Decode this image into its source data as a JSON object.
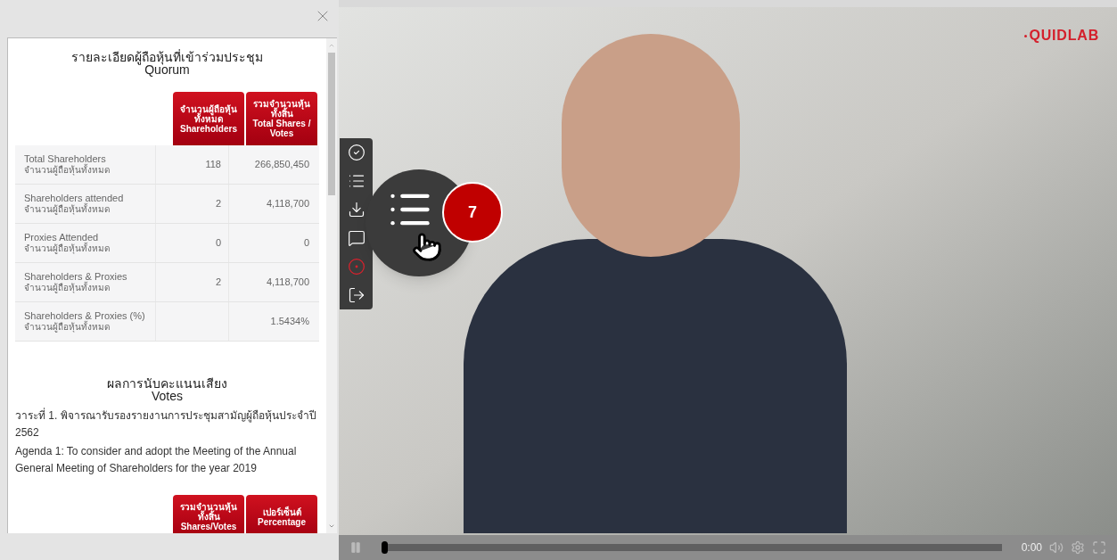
{
  "quorum": {
    "title_th": "รายละเอียดผู้ถือหุ้นที่เข้าร่วมประชุม",
    "title_en": "Quorum",
    "columns": [
      {
        "th": "จำนวนผู้ถือหุ้นทั้งหมด",
        "en": "Shareholders"
      },
      {
        "th": "รวมจำนวนหุ้นทั้งสิ้น",
        "en": "Total Shares / Votes"
      }
    ],
    "rows": [
      {
        "label_en": "Total Shareholders",
        "label_th": "จำนวนผู้ถือหุ้นทั้งหมด",
        "shareholders": "118",
        "shares": "266,850,450"
      },
      {
        "label_en": "Shareholders attended",
        "label_th": "จำนวนผู้ถือหุ้นทั้งหมด",
        "shareholders": "2",
        "shares": "4,118,700"
      },
      {
        "label_en": "Proxies Attended",
        "label_th": "จำนวนผู้ถือหุ้นทั้งหมด",
        "shareholders": "0",
        "shares": "0"
      },
      {
        "label_en": "Shareholders & Proxies",
        "label_th": "จำนวนผู้ถือหุ้นทั้งหมด",
        "shareholders": "2",
        "shares": "4,118,700"
      },
      {
        "label_en": "Shareholders & Proxies (%)",
        "label_th": "จำนวนผู้ถือหุ้นทั้งหมด",
        "shares": "1.5434%"
      }
    ]
  },
  "votes": {
    "title_th": "ผลการนับคะแนนเสียง",
    "title_en": "Votes",
    "agenda_th": "วาระที่ 1. พิจารณารับรองรายงานการประชุมสามัญผู้ถือหุ้นประจำปี 2562",
    "agenda_en": "Agenda 1: To consider and adopt the Meeting of the Annual General Meeting of Shareholders for the year 2019",
    "columns": [
      {
        "th": "รวมจำนวนหุ้นทั้งสิ้น",
        "en": "Shares/Votes"
      },
      {
        "th": "เปอร์เซ็นต์",
        "en": "Percentage"
      }
    ]
  },
  "video": {
    "logo": "QUIDLAB",
    "toolbar": [
      {
        "kind": "check"
      },
      {
        "kind": "list"
      },
      {
        "kind": "download"
      },
      {
        "kind": "chat"
      },
      {
        "kind": "record"
      },
      {
        "kind": "exit"
      }
    ],
    "callout_badge": "7",
    "controls": {
      "level": 0,
      "time": "0:00"
    }
  }
}
